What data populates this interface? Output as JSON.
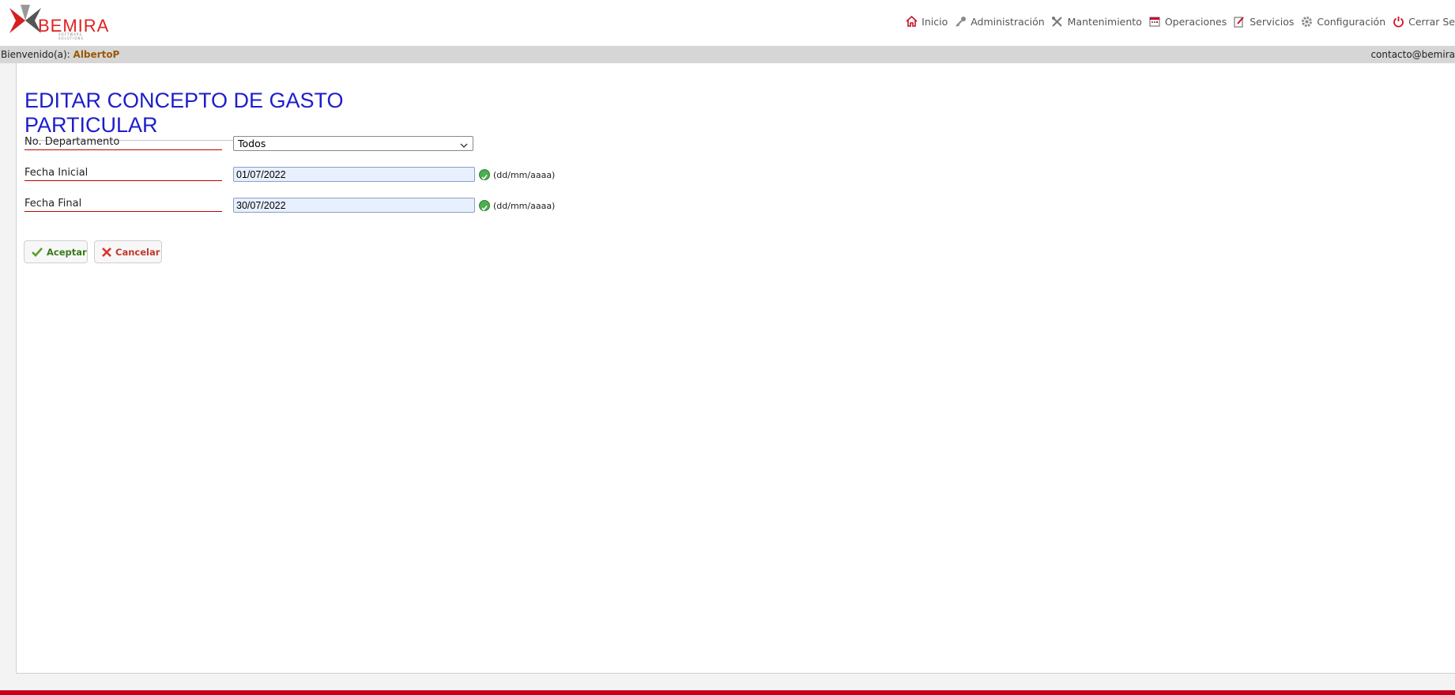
{
  "brand": {
    "name": "BEMIRA",
    "tagline": "SOFTWARE SOLUTIONS"
  },
  "nav": [
    {
      "label": "Inicio",
      "icon": "home-icon"
    },
    {
      "label": "Administración",
      "icon": "key-icon"
    },
    {
      "label": "Mantenimiento",
      "icon": "tools-icon"
    },
    {
      "label": "Operaciones",
      "icon": "calendar-icon"
    },
    {
      "label": "Servicios",
      "icon": "edit-icon"
    },
    {
      "label": "Configuración",
      "icon": "gear-icon"
    },
    {
      "label": "Cerrar Se",
      "icon": "power-icon"
    }
  ],
  "welcome": {
    "prefix": "Bienvenido(a):",
    "user": "AlbertoP",
    "email": "contacto@bemira"
  },
  "page": {
    "title": "EDITAR CONCEPTO DE GASTO PARTICULAR"
  },
  "form": {
    "departamento": {
      "label": "No. Departamento",
      "value": "Todos"
    },
    "fecha_inicial": {
      "label": "Fecha Inicial",
      "value": "01/07/2022",
      "format": "(dd/mm/aaaa)"
    },
    "fecha_final": {
      "label": "Fecha Final",
      "value": "30/07/2022",
      "format": "(dd/mm/aaaa)"
    }
  },
  "buttons": {
    "accept": "Aceptar",
    "cancel": "Cancelar"
  },
  "colors": {
    "accent": "#c8001e",
    "title": "#1d1dcc",
    "user": "#9a5a00"
  }
}
